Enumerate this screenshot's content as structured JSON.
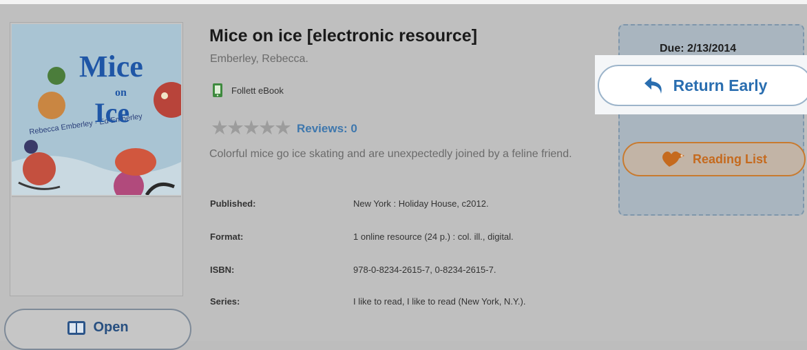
{
  "book": {
    "title": "Mice on ice [electronic resource]",
    "author": "Emberley, Rebecca.",
    "format_label": "Follett eBook",
    "stars": "★★★★★",
    "reviews": "Reviews: 0",
    "summary": "Colorful mice go ice skating and are unexpectedly joined by a feline friend."
  },
  "cover": {
    "title_word1": "Mice",
    "title_word2": "on",
    "title_word3": "Ice",
    "accent": "#a9c4d3"
  },
  "meta": [
    {
      "key": "Published:",
      "value": "New York : Holiday House, c2012."
    },
    {
      "key": "Format:",
      "value": "1 online resource (24 p.) : col. ill., digital."
    },
    {
      "key": "ISBN:",
      "value": "978-0-8234-2615-7, 0-8234-2615-7."
    },
    {
      "key": "Series:",
      "value": "I like to read, I like to read (New York, N.Y.)."
    }
  ],
  "actions": {
    "open_label": "Open",
    "due": "Due: 2/13/2014",
    "return_label": "Return Early",
    "reading_list_label": "Reading List"
  },
  "colors": {
    "link_blue": "#3e77ad",
    "return_blue": "#2a6eb0",
    "reading_orange": "#c56a1e",
    "ebook_green": "#3e8a3e"
  },
  "icons": {
    "open": "book-open-icon",
    "format": "ebook-icon",
    "return": "undo-arrow-icon",
    "reading_list": "heart-tag-icon"
  }
}
